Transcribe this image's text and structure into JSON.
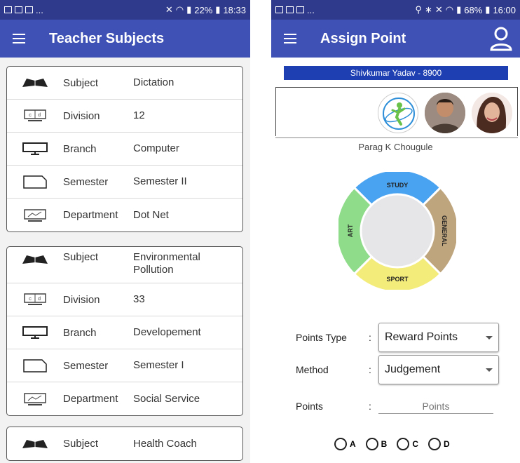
{
  "left": {
    "status": {
      "right_text": "22%",
      "time": "18:33",
      "left_dots": "..."
    },
    "appbar": {
      "title": "Teacher Subjects"
    },
    "cards": [
      {
        "rows": [
          {
            "icon": "book-icon",
            "label": "Subject",
            "value": "Dictation"
          },
          {
            "icon": "division-icon",
            "label": "Division",
            "value": "12"
          },
          {
            "icon": "monitor-icon",
            "label": "Branch",
            "value": "Computer"
          },
          {
            "icon": "semester-icon",
            "label": "Semester",
            "value": "Semester II"
          },
          {
            "icon": "department-icon",
            "label": "Department",
            "value": "Dot Net"
          }
        ]
      },
      {
        "rows": [
          {
            "icon": "book-icon",
            "label": "Subject",
            "value": "Environmental Pollution"
          },
          {
            "icon": "division-icon",
            "label": "Division",
            "value": "33"
          },
          {
            "icon": "monitor-icon",
            "label": "Branch",
            "value": "Developement"
          },
          {
            "icon": "semester-icon",
            "label": "Semester",
            "value": "Semester I"
          },
          {
            "icon": "department-icon",
            "label": "Department",
            "value": "Social Service"
          }
        ]
      },
      {
        "rows": [
          {
            "icon": "book-icon",
            "label": "Subject",
            "value": "Health Coach"
          }
        ]
      }
    ]
  },
  "right": {
    "status": {
      "right_text": "68%",
      "time": "16:00",
      "left_dots": "..."
    },
    "appbar": {
      "title": "Assign Point"
    },
    "person_bar": "Shivkumar  Yadav - 8900",
    "teacher_name": "Parag K Chougule",
    "ring": {
      "top": "STUDY",
      "right": "GENERAL",
      "bottom": "SPORT",
      "left": "ART",
      "colors": {
        "study": "#4aa3f0",
        "general": "#bfa57e",
        "sport": "#f4ec7a",
        "art": "#8fdc8a",
        "center": "#e6e6e9"
      }
    },
    "form": {
      "points_type_label": "Points Type",
      "points_type_value": "Reward Points",
      "method_label": "Method",
      "method_value": "Judgement",
      "points_label": "Points",
      "points_placeholder": "Points",
      "colon": ":"
    },
    "radios": [
      "A",
      "B",
      "C",
      "D"
    ]
  },
  "colors": {
    "statusbar": "#2f3a8c",
    "appbar": "#3f51b5",
    "person_bar": "#1e3fb2"
  }
}
